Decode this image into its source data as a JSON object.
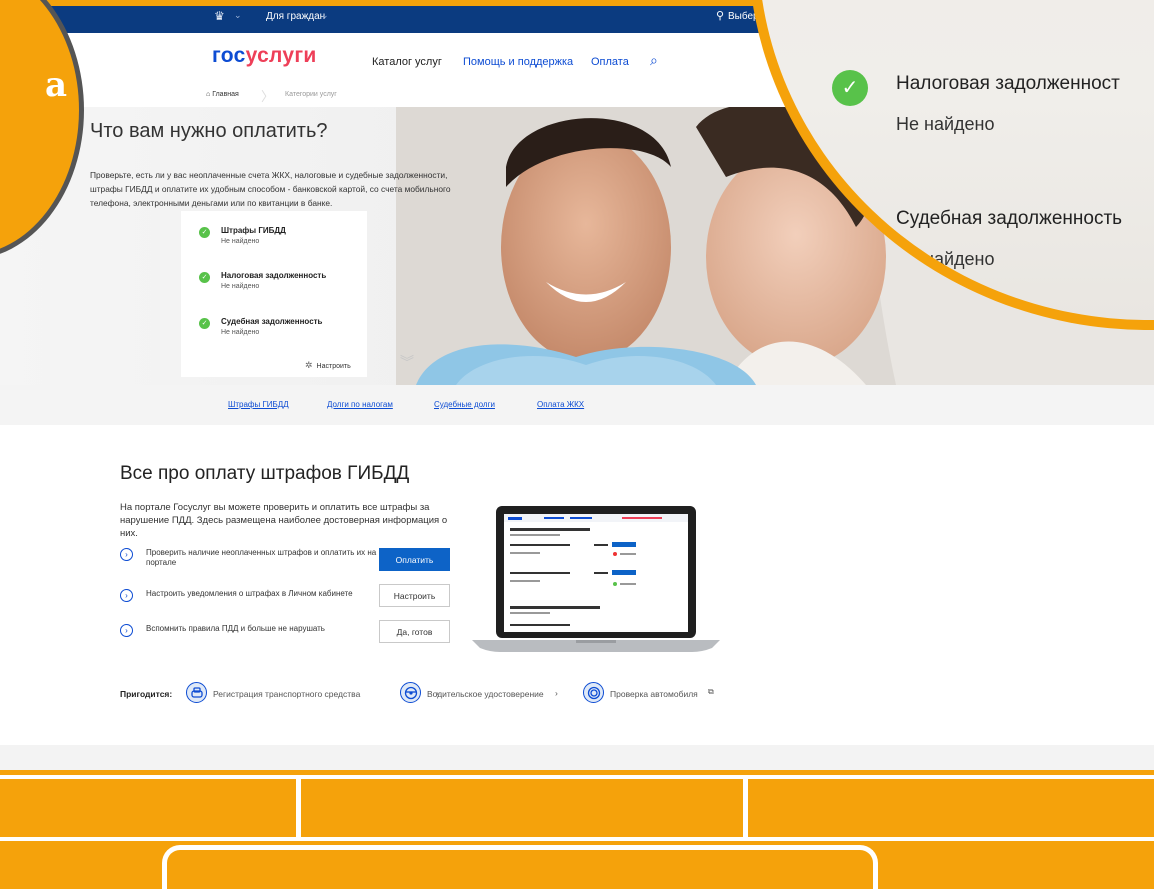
{
  "topbar": {
    "citizens_label": "Для граждан",
    "location_label": "Выбер"
  },
  "header": {
    "logo_part1": "гос",
    "logo_part2": "услуги",
    "nav": [
      "Каталог услуг",
      "Помощь и поддержка",
      "Оплата"
    ]
  },
  "breadcrumb": {
    "home": "Главная",
    "current": "Категории услуг"
  },
  "hero": {
    "title": "Что вам нужно оплатить?",
    "description": "Проверьте, есть ли у вас неоплаченные счета ЖКХ, налоговые и судебные задолженности, штрафы ГИБДД и оплатите их удобным способом - банковской картой, со счета мобильного телефона, электронными деньгами или по квитанции в банке.",
    "checks": [
      {
        "title": "Штрафы ГИБДД",
        "status": "Не найдено"
      },
      {
        "title": "Налоговая задолженность",
        "status": "Не найдено"
      },
      {
        "title": "Судебная задолженность",
        "status": "Не найдено"
      }
    ],
    "configure_label": "Настроить"
  },
  "quick_links": [
    "Штрафы ГИБДД",
    "Долги по налогам",
    "Судебные долги",
    "Оплата ЖКХ"
  ],
  "section": {
    "title": "Все про оплату штрафов ГИБДД",
    "description": "На портале Госуслуг вы можете проверить и оплатить все штрафы за нарушение ПДД. Здесь размещена наиболее достоверная информация о них.",
    "rows": [
      {
        "text": "Проверить наличие неоплаченных штрафов и оплатить их на портале",
        "button": "Оплатить"
      },
      {
        "text": "Настроить уведомления о штрафах в Личном кабинете",
        "button": "Настроить"
      },
      {
        "text": "Вспомнить правила ПДД и больше не нарушать",
        "button": "Да, готов"
      }
    ]
  },
  "useful": {
    "label": "Пригодится:",
    "items": [
      {
        "label": "Регистрация транспортного средства",
        "icon": "car-icon"
      },
      {
        "label": "Водительское удостоверение",
        "icon": "steering-wheel-icon"
      },
      {
        "label": "Проверка автомобиля",
        "icon": "tire-icon"
      }
    ]
  },
  "magnifier_left": {
    "text": "a"
  },
  "magnifier_right": {
    "checks": [
      {
        "title": "Налоговая задолженност",
        "status": "Не найдено"
      },
      {
        "title": "Судебная задолженность",
        "status": "Не найдено"
      }
    ]
  },
  "colors": {
    "accent_orange": "#f5a20b",
    "brand_blue": "#0d4cd3",
    "brand_red": "#ee3f58",
    "topbar_navy": "#0b3b80",
    "success_green": "#58c24a"
  }
}
